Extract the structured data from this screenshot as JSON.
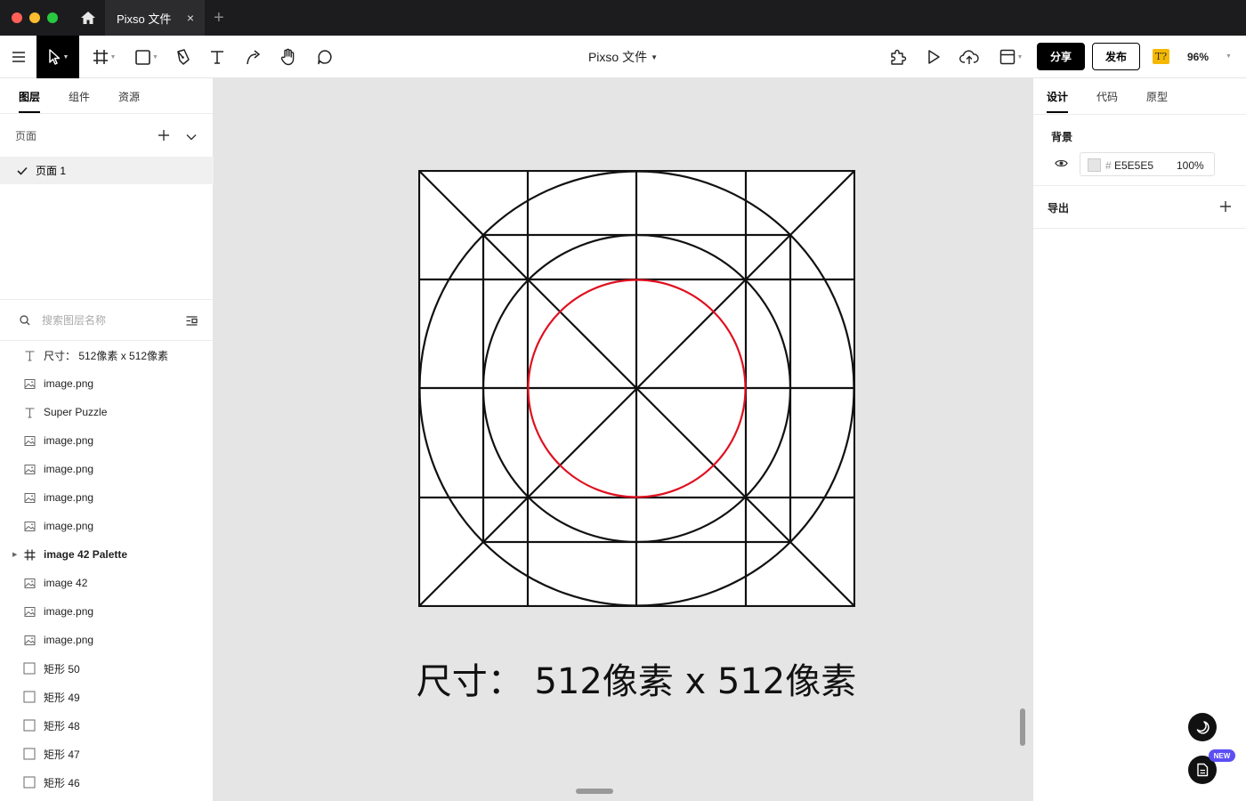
{
  "titlebar": {
    "tab_title": "Pixso 文件",
    "close_glyph": "×",
    "new_tab_glyph": "+"
  },
  "toolbar": {
    "doc_title": "Pixso 文件",
    "share_label": "分享",
    "publish_label": "发布",
    "font_badge": "T?",
    "zoom": "96%"
  },
  "left_panel": {
    "tabs": [
      "图层",
      "组件",
      "资源"
    ],
    "pages_label": "页面",
    "current_page": "页面 1",
    "search_placeholder": "搜索图层名称",
    "layers": [
      {
        "name": "尺寸：  512像素 x 512像素",
        "icon": "text-icon"
      },
      {
        "name": "image.png",
        "icon": "image-icon"
      },
      {
        "name": "Super Puzzle",
        "icon": "text-icon"
      },
      {
        "name": "image.png",
        "icon": "image-icon"
      },
      {
        "name": "image.png",
        "icon": "image-icon"
      },
      {
        "name": "image.png",
        "icon": "image-icon"
      },
      {
        "name": "image.png",
        "icon": "image-icon"
      },
      {
        "name": "image 42 Palette",
        "icon": "frame-icon"
      },
      {
        "name": "image 42",
        "icon": "image-icon"
      },
      {
        "name": "image.png",
        "icon": "image-icon"
      },
      {
        "name": "image.png",
        "icon": "image-icon"
      },
      {
        "name": "矩形 50",
        "icon": "rect-icon"
      },
      {
        "name": "矩形 49",
        "icon": "rect-icon"
      },
      {
        "name": "矩形 48",
        "icon": "rect-icon"
      },
      {
        "name": "矩形 47",
        "icon": "rect-icon"
      },
      {
        "name": "矩形 46",
        "icon": "rect-icon"
      }
    ]
  },
  "canvas": {
    "caption": "尺寸：  512像素 x 512像素",
    "background": "#E5E5E5",
    "grid_stroke": "#111111",
    "highlight_stroke": "#e01020"
  },
  "right_panel": {
    "tabs": [
      "设计",
      "代码",
      "原型"
    ],
    "background_label": "背景",
    "hash": "#",
    "hex": "E5E5E5",
    "opacity": "100%",
    "export_label": "导出"
  },
  "badges": {
    "new": "NEW"
  },
  "colors": {
    "accent_black": "#000000",
    "new_badge": "#5b4ef5",
    "font_badge": "#f5b800"
  }
}
